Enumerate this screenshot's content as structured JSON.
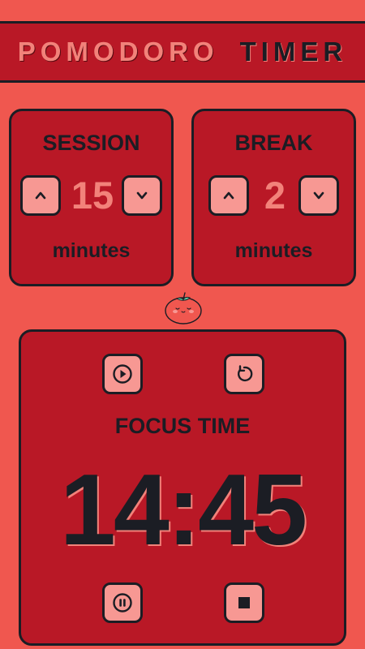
{
  "header": {
    "title_part1": "POMODORO",
    "title_part2": "TIMER"
  },
  "session": {
    "title": "SESSION",
    "value": "15",
    "unit": "minutes",
    "up_icon": "chevron-up-icon",
    "down_icon": "chevron-down-icon"
  },
  "break": {
    "title": "BREAK",
    "value": "2",
    "unit": "minutes",
    "up_icon": "chevron-up-icon",
    "down_icon": "chevron-down-icon"
  },
  "mascot": {
    "icon": "tomato-icon"
  },
  "timer": {
    "label": "FOCUS TIME",
    "time": "14:45",
    "controls": [
      "play-icon",
      "reset-icon",
      "pause-icon",
      "stop-icon"
    ]
  },
  "colors": {
    "background": "#f0574f",
    "panel": "#b91826",
    "button": "#f79893",
    "accent_text": "#f2827a",
    "dark": "#1b1d24"
  }
}
